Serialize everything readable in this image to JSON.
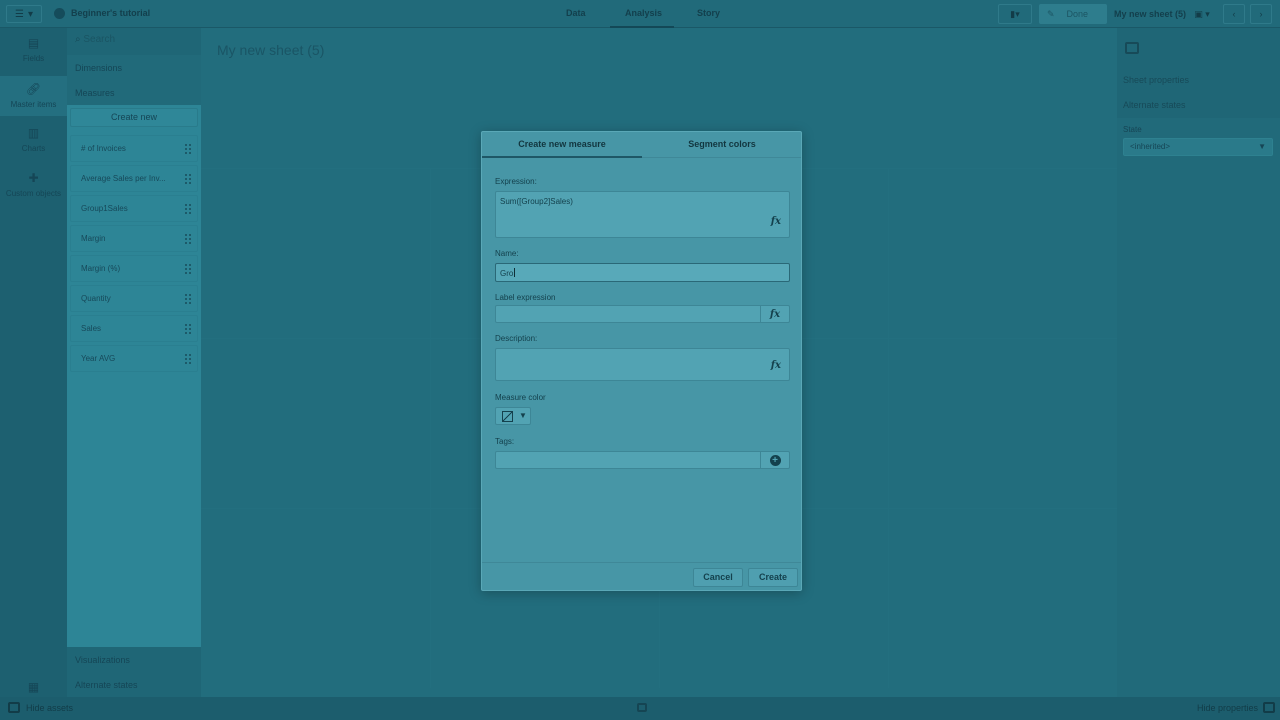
{
  "topbar": {
    "app_name": "Beginner's tutorial",
    "tabs": [
      "Data",
      "Analysis",
      "Story"
    ],
    "edit_label": "Done",
    "sheet_name": "My new sheet (5)"
  },
  "rail": {
    "items": [
      {
        "label": "Fields",
        "icon": "fields-icon"
      },
      {
        "label": "Master items",
        "icon": "link-icon"
      },
      {
        "label": "Charts",
        "icon": "chart-icon"
      },
      {
        "label": "Custom objects",
        "icon": "puzzle-icon"
      }
    ]
  },
  "assets": {
    "search_placeholder": "Search",
    "sections": [
      "Dimensions",
      "Measures"
    ],
    "create_new_label": "Create new",
    "measures": [
      "# of Invoices",
      "Average Sales per Inv...",
      "Group1Sales",
      "Margin",
      "Margin (%)",
      "Quantity",
      "Sales",
      "Year AVG"
    ],
    "bottom_sections": [
      "Visualizations",
      "Alternate states"
    ]
  },
  "canvas": {
    "sheet_title": "My new sheet (5)"
  },
  "props": {
    "items": [
      "Sheet properties",
      "Alternate states"
    ],
    "state_label": "State",
    "state_value": "<inherited>"
  },
  "bottombar": {
    "hide_assets": "Hide assets",
    "hide_properties": "Hide properties"
  },
  "dialog": {
    "tabs": [
      "Create new measure",
      "Segment colors"
    ],
    "expression_label": "Expression:",
    "expression_value": "Sum([Group2]Sales)",
    "name_label": "Name:",
    "name_value": "Gro",
    "label_expression_label": "Label expression",
    "description_label": "Description:",
    "measure_color_label": "Measure color",
    "tags_label": "Tags:",
    "cancel_label": "Cancel",
    "create_label": "Create"
  }
}
